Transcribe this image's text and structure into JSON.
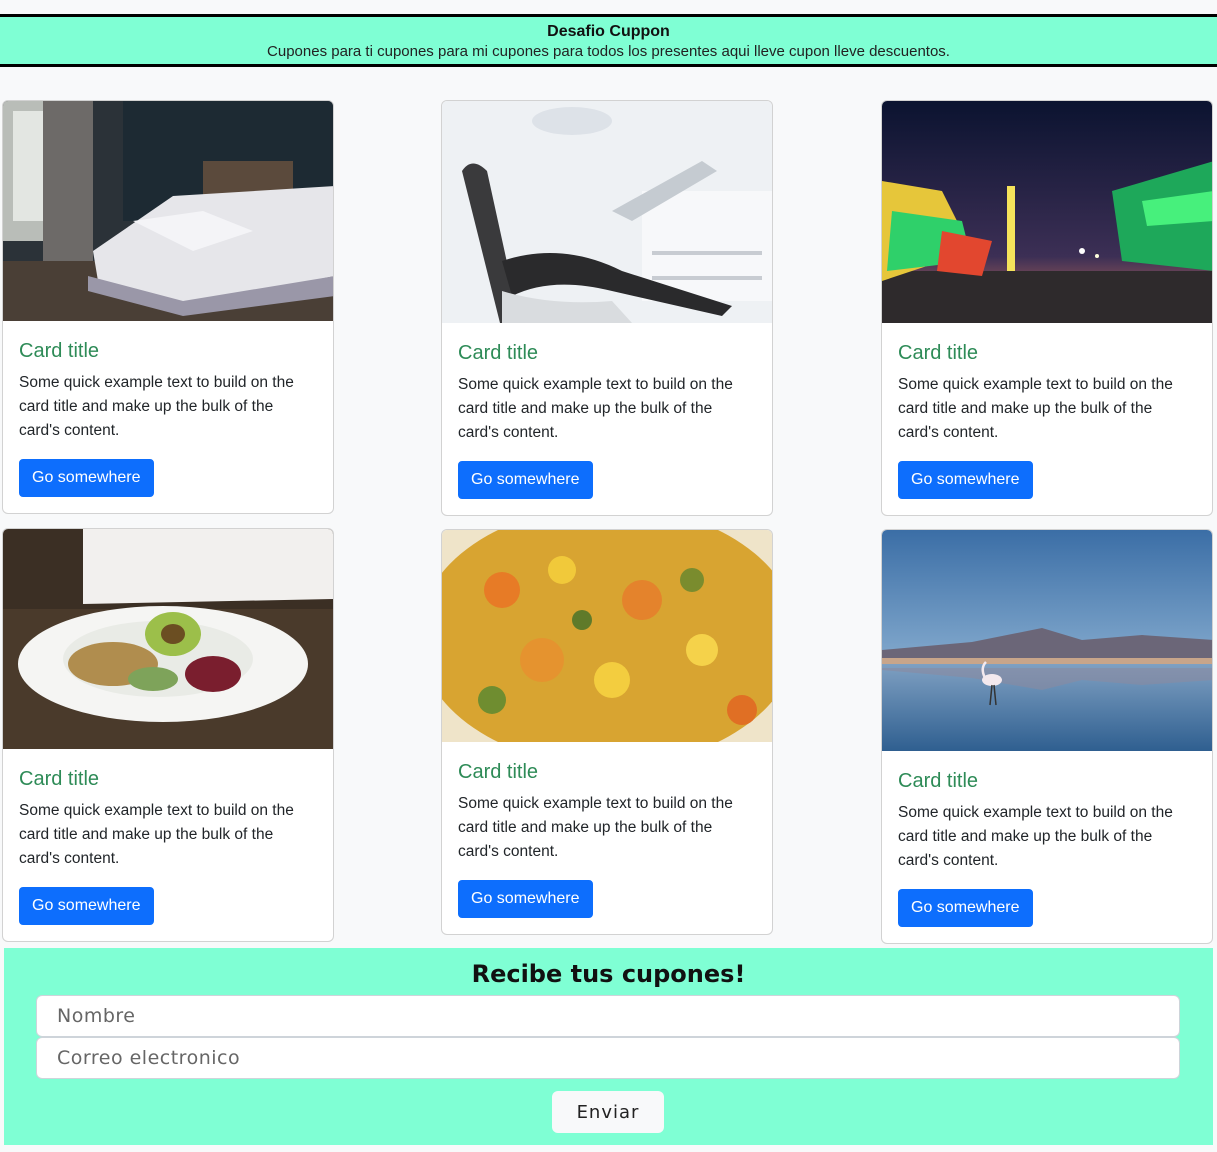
{
  "header": {
    "title": "Desafio Cuppon",
    "subtitle": "Cupones para ti cupones para mi cupones para todos los presentes aqui lleve cupon lleve descuentos."
  },
  "cards": [
    {
      "image": "bedroom-photo",
      "title": "Card title",
      "text": "Some quick example text to build on the card title and make up the bulk of the card's content.",
      "button": "Go somewhere"
    },
    {
      "image": "dental-chair-photo",
      "title": "Card title",
      "text": "Some quick example text to build on the card title and make up the bulk of the card's content.",
      "button": "Go somewhere"
    },
    {
      "image": "carnival-night-photo",
      "title": "Card title",
      "text": "Some quick example text to build on the card title and make up the bulk of the card's content.",
      "button": "Go somewhere"
    },
    {
      "image": "salad-bowl-photo",
      "title": "Card title",
      "text": "Some quick example text to build on the card title and make up the bulk of the card's content.",
      "button": "Go somewhere"
    },
    {
      "image": "vegetable-dish-photo",
      "title": "Card title",
      "text": "Some quick example text to build on the card title and make up the bulk of the card's content.",
      "button": "Go somewhere"
    },
    {
      "image": "flamingo-lake-photo",
      "title": "Card title",
      "text": "Some quick example text to build on the card title and make up the bulk of the card's content.",
      "button": "Go somewhere"
    }
  ],
  "form": {
    "title": "Recibe tus cupones!",
    "name_placeholder": "Nombre",
    "email_placeholder": "Correo electronico",
    "submit_label": "Enviar"
  },
  "colors": {
    "accent_bg": "#7fffd4",
    "button_primary": "#0d6efd",
    "card_title": "#2e8b57"
  }
}
